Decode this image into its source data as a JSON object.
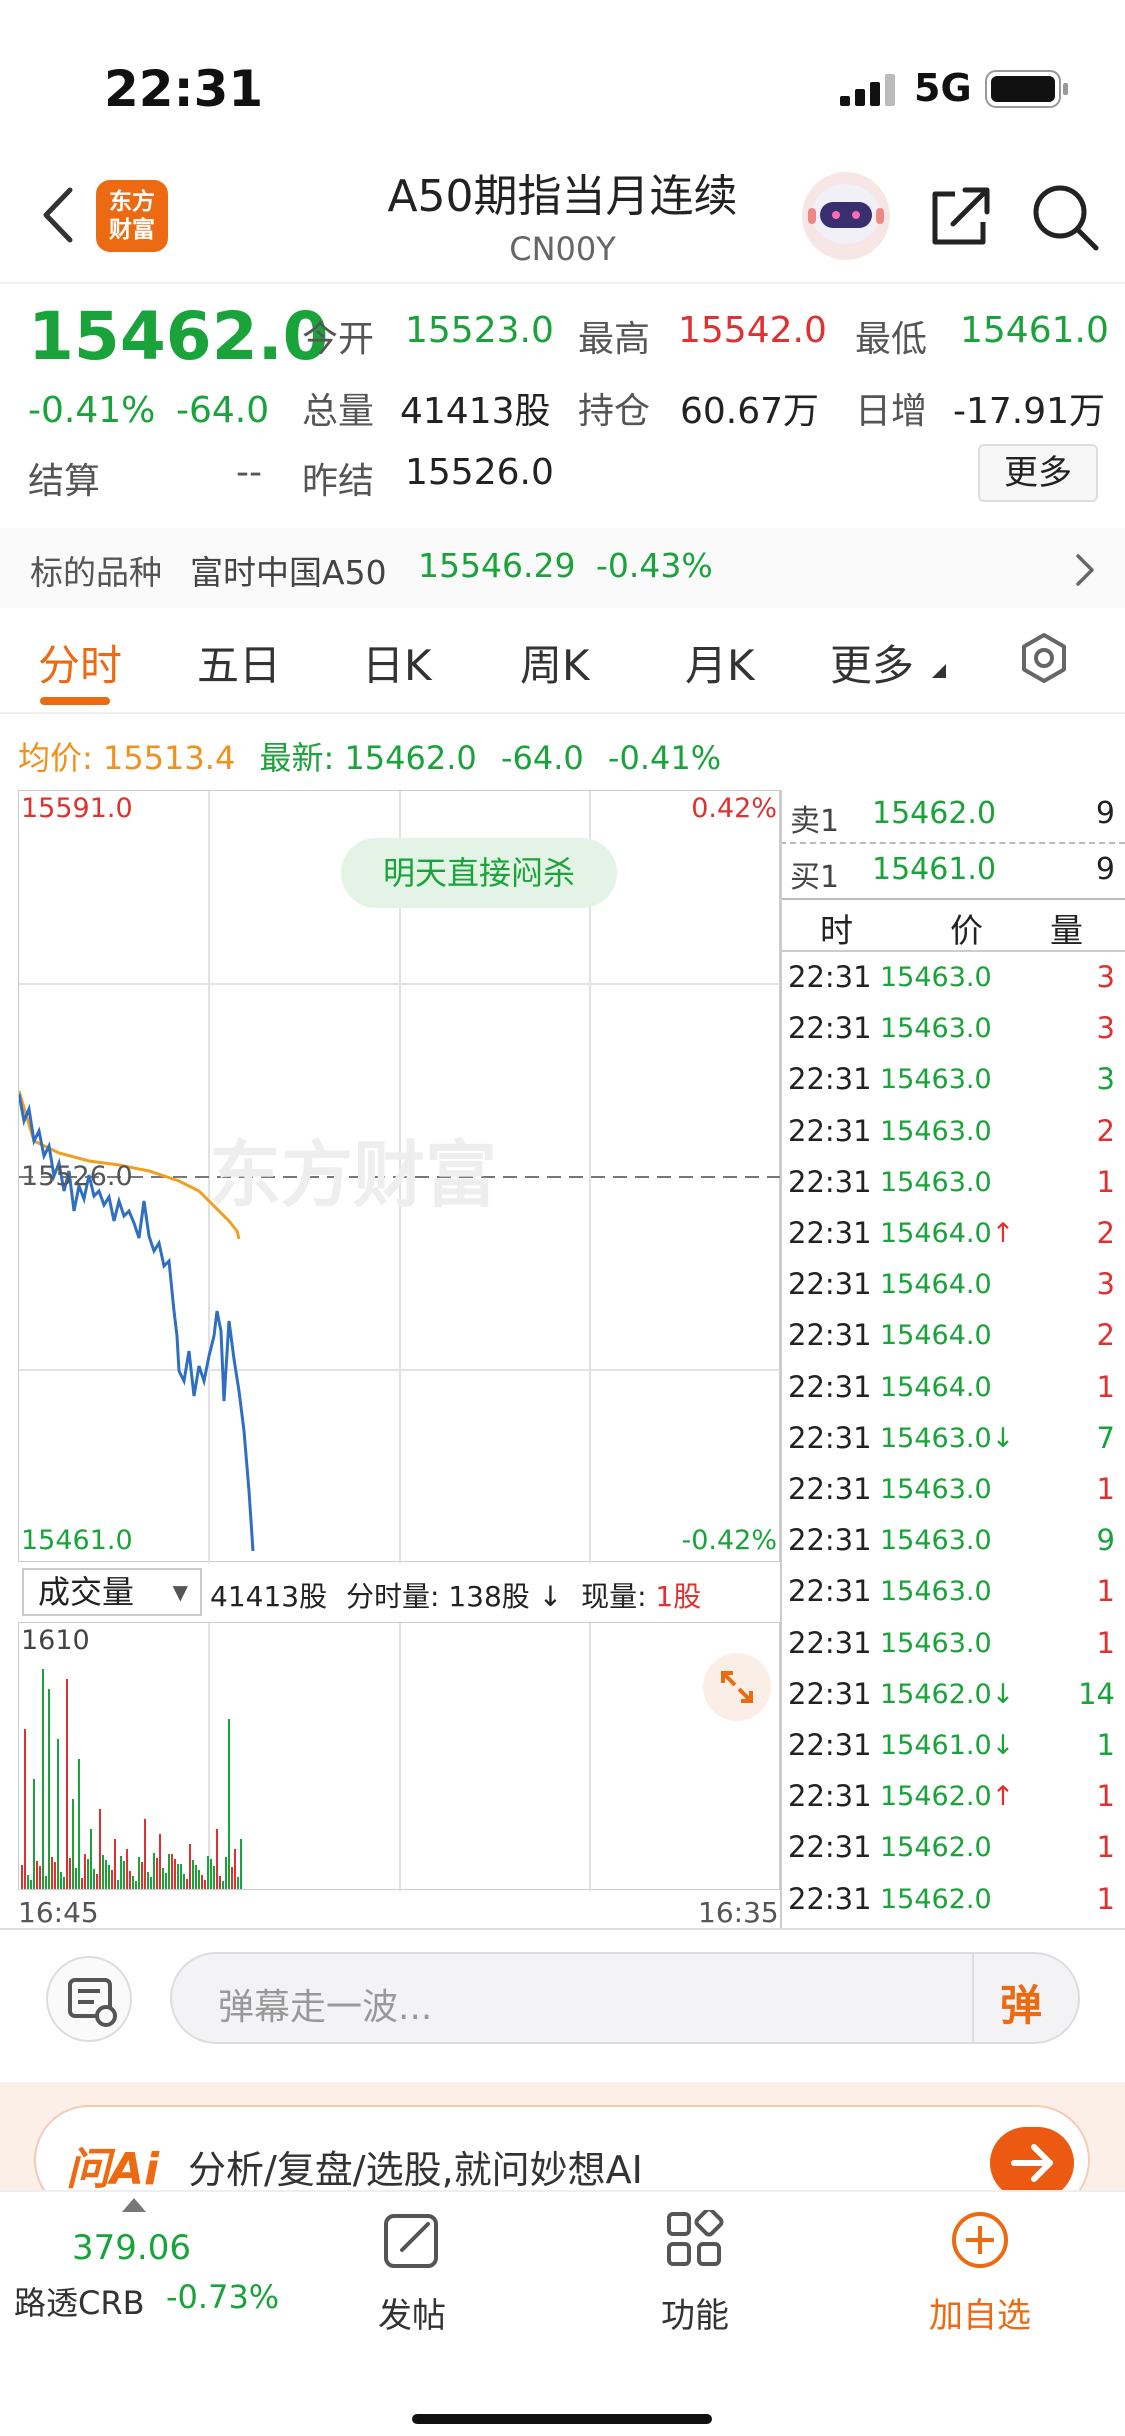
{
  "status_bar": {
    "time": "22:31",
    "network": "5G"
  },
  "header": {
    "logo_text": [
      "东方",
      "财富"
    ],
    "title": "A50期指当月连续",
    "code": "CN00Y"
  },
  "quote": {
    "price": "15462.0",
    "change_pct": "-0.41%",
    "change": "-64.0",
    "open_label": "今开",
    "open": "15523.0",
    "high_label": "最高",
    "high": "15542.0",
    "low_label": "最低",
    "low": "15461.0",
    "volume_label": "总量",
    "volume": "41413股",
    "oi_label": "持仓",
    "oi": "60.67万",
    "daily_inc_label": "日增",
    "daily_inc": "-17.91万",
    "settle_label": "结算",
    "settle": "--",
    "prev_settle_label": "昨结",
    "prev_settle": "15526.0",
    "more_label": "更多"
  },
  "underlying": {
    "label": "标的品种",
    "name": "富时中国A50",
    "price": "15546.29",
    "pct": "-0.43%"
  },
  "tabs": [
    "分时",
    "五日",
    "日K",
    "周K",
    "月K",
    "更多"
  ],
  "legend": {
    "avg_label": "均价:",
    "avg": "15513.4",
    "last_label": "最新:",
    "last": "15462.0",
    "chg": "-64.0",
    "pct": "-0.41%"
  },
  "chart_axes": {
    "top_price": "15591.0",
    "top_pct": "0.42%",
    "mid_price": "15526.0",
    "bottom_price": "15461.0",
    "bottom_pct": "-0.42%",
    "vol_top": "1610",
    "start_time": "16:45",
    "end_time": "16:35"
  },
  "chart_badge": "明天直接闷杀",
  "watermark": "东方财富",
  "volume_bar": {
    "selector": "成交量",
    "total": "41413股",
    "tick_vol_label": "分时量:",
    "tick_vol": "138股",
    "arrow": "↓",
    "cur_label": "现量:",
    "cur": "1股"
  },
  "orderbook": {
    "ask_label": "卖1",
    "ask_price": "15462.0",
    "ask_vol": "9",
    "bid_label": "买1",
    "bid_price": "15461.0",
    "bid_vol": "9"
  },
  "trades_header": {
    "time": "时",
    "price": "价",
    "vol": "量"
  },
  "trades": [
    {
      "time": "22:31",
      "price": "15463.0",
      "arrow": "",
      "vol": "3",
      "vc": "red"
    },
    {
      "time": "22:31",
      "price": "15463.0",
      "arrow": "",
      "vol": "3",
      "vc": "red"
    },
    {
      "time": "22:31",
      "price": "15463.0",
      "arrow": "",
      "vol": "3",
      "vc": "green"
    },
    {
      "time": "22:31",
      "price": "15463.0",
      "arrow": "",
      "vol": "2",
      "vc": "red"
    },
    {
      "time": "22:31",
      "price": "15463.0",
      "arrow": "",
      "vol": "1",
      "vc": "red"
    },
    {
      "time": "22:31",
      "price": "15464.0",
      "arrow": "↑",
      "vol": "2",
      "vc": "red"
    },
    {
      "time": "22:31",
      "price": "15464.0",
      "arrow": "",
      "vol": "3",
      "vc": "red"
    },
    {
      "time": "22:31",
      "price": "15464.0",
      "arrow": "",
      "vol": "2",
      "vc": "red"
    },
    {
      "time": "22:31",
      "price": "15464.0",
      "arrow": "",
      "vol": "1",
      "vc": "red"
    },
    {
      "time": "22:31",
      "price": "15463.0",
      "arrow": "↓",
      "vol": "7",
      "vc": "green"
    },
    {
      "time": "22:31",
      "price": "15463.0",
      "arrow": "",
      "vol": "1",
      "vc": "red"
    },
    {
      "time": "22:31",
      "price": "15463.0",
      "arrow": "",
      "vol": "9",
      "vc": "green"
    },
    {
      "time": "22:31",
      "price": "15463.0",
      "arrow": "",
      "vol": "1",
      "vc": "red"
    },
    {
      "time": "22:31",
      "price": "15463.0",
      "arrow": "",
      "vol": "1",
      "vc": "red"
    },
    {
      "time": "22:31",
      "price": "15462.0",
      "arrow": "↓",
      "vol": "14",
      "vc": "green"
    },
    {
      "time": "22:31",
      "price": "15461.0",
      "arrow": "↓",
      "vol": "1",
      "vc": "green"
    },
    {
      "time": "22:31",
      "price": "15462.0",
      "arrow": "↑",
      "vol": "1",
      "vc": "red"
    },
    {
      "time": "22:31",
      "price": "15462.0",
      "arrow": "",
      "vol": "1",
      "vc": "red"
    },
    {
      "time": "22:31",
      "price": "15462.0",
      "arrow": "",
      "vol": "1",
      "vc": "red"
    }
  ],
  "danmu": {
    "placeholder": "弹幕走一波...",
    "send_label": "弹"
  },
  "ai": {
    "brand": "问Ai",
    "text": "分析/复盘/选股,就问妙想AI"
  },
  "bottom_nav": {
    "index_value": "379.06",
    "index_name": "路透CRB",
    "index_pct": "-0.73%",
    "post": "发帖",
    "func": "功能",
    "add": "加自选"
  },
  "colors": {
    "up": "#e03030",
    "down": "#1aa33a",
    "accent": "#ec6a12",
    "avg_line": "#f0a020",
    "price_line": "#2f6fc2"
  }
}
